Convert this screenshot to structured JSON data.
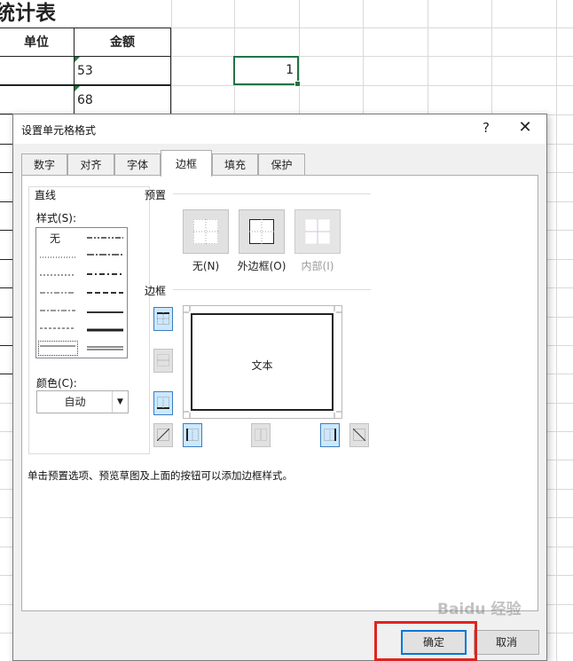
{
  "sheet": {
    "title": "统计表",
    "header_unit": "单位",
    "header_amount": "金额",
    "rows": [
      "53",
      "68"
    ],
    "selected_cell_value": "1",
    "accent": "#217346"
  },
  "dialog": {
    "title": "设置单元格格式",
    "help": "?",
    "close": "✕",
    "tabs": [
      {
        "label": "数字"
      },
      {
        "label": "对齐"
      },
      {
        "label": "字体"
      },
      {
        "label": "边框"
      },
      {
        "label": "填充"
      },
      {
        "label": "保护"
      }
    ],
    "active_tab": "边框",
    "line_group": {
      "label": "直线",
      "style_label": "样式(S):",
      "style_none": "无",
      "color_label": "颜色(C):",
      "color_value": "自动"
    },
    "presets": {
      "label": "预置",
      "none": "无(N)",
      "outline": "外边框(O)",
      "inside": "内部(I)"
    },
    "border": {
      "label": "边框",
      "preview_text": "文本"
    },
    "hint": "单击预置选项、预览草图及上面的按钮可以添加边框样式。",
    "ok": "确定",
    "cancel": "取消",
    "ok_border_color": "#0078d7"
  },
  "annotation": {
    "highlight_color": "#e0231f"
  },
  "watermark": "Baidu 经验"
}
